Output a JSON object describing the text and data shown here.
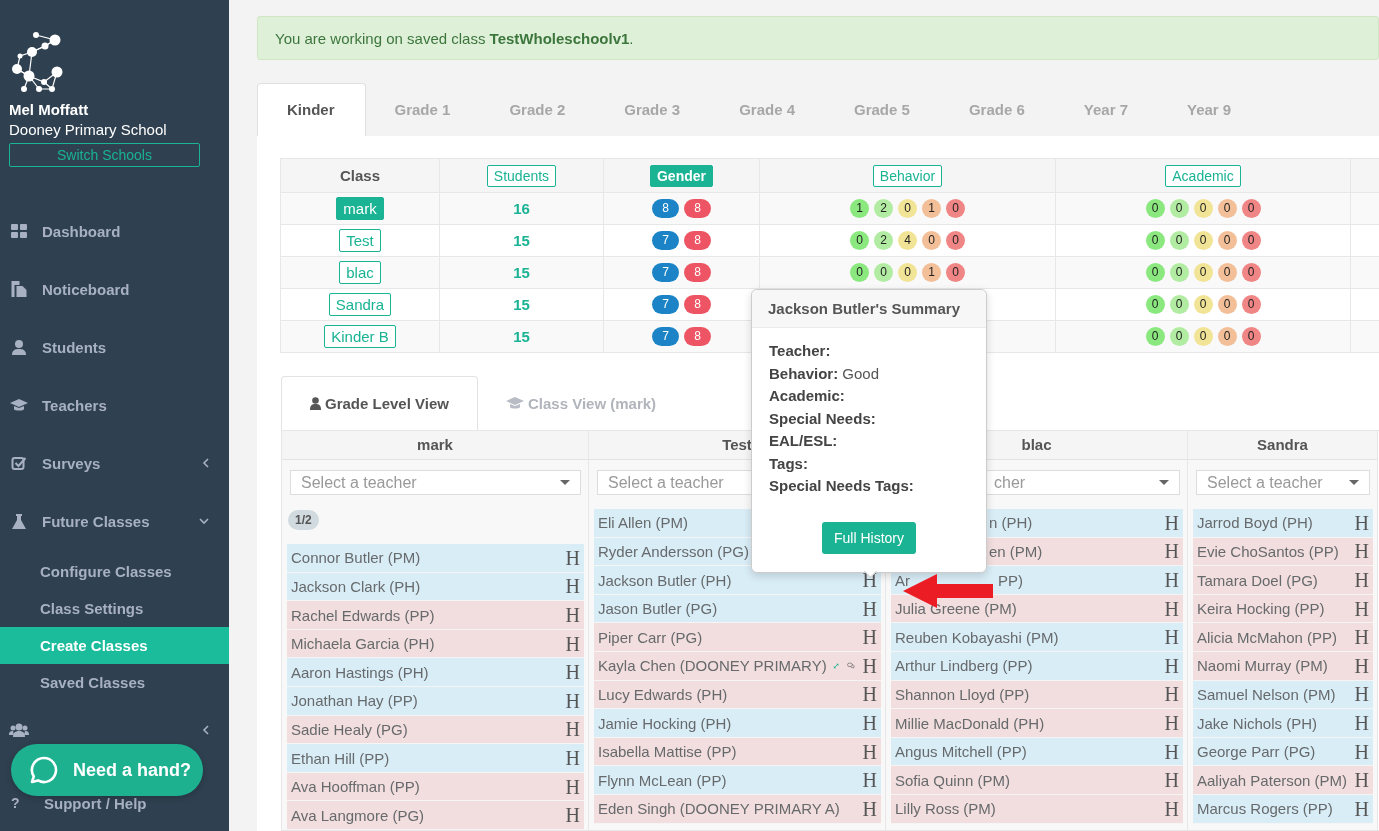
{
  "sidebar": {
    "user": "Mel Moffatt",
    "school": "Dooney Primary School",
    "switch_button": "Switch Schools",
    "nav": [
      {
        "label": "Dashboard"
      },
      {
        "label": "Noticeboard"
      },
      {
        "label": "Students"
      },
      {
        "label": "Teachers"
      },
      {
        "label": "Surveys",
        "expanded": false
      },
      {
        "label": "Future Classes",
        "expanded": true,
        "children": [
          {
            "label": "Configure Classes",
            "selected": false
          },
          {
            "label": "Class Settings",
            "selected": false
          },
          {
            "label": "Create Classes",
            "selected": true
          },
          {
            "label": "Saved Classes",
            "selected": false
          }
        ]
      },
      {
        "expanded": false
      },
      {
        "label": "Support / Help",
        "glyph": "?"
      }
    ]
  },
  "chat_button": "Need a hand?",
  "alert": "You are working on saved class **TestWholeschoolv1**.",
  "grade_tabs": [
    {
      "label": "Kinder",
      "selected": true
    },
    {
      "label": "Grade 1",
      "selected": false
    },
    {
      "label": "Grade 2",
      "selected": false
    },
    {
      "label": "Grade 3",
      "selected": false
    },
    {
      "label": "Grade 4",
      "selected": false
    },
    {
      "label": "Grade 5",
      "selected": false
    },
    {
      "label": "Grade 6",
      "selected": false
    },
    {
      "label": "Year 7",
      "selected": false
    },
    {
      "label": "Year 9",
      "selected": false
    }
  ],
  "summary": {
    "columns": [
      {
        "label": "Class",
        "kind": "plain"
      },
      {
        "label": "Students",
        "kind": "toggle",
        "selected": false
      },
      {
        "label": "Gender",
        "kind": "toggle",
        "selected": true
      },
      {
        "label": "Behavior",
        "kind": "toggle",
        "selected": false
      },
      {
        "label": "Academic",
        "kind": "toggle",
        "selected": false
      }
    ],
    "rows": [
      {
        "class": "mark",
        "selected": true,
        "students": "16",
        "boys": "8",
        "girls": "8",
        "behavior": [
          "1",
          "2",
          "0",
          "1",
          "0"
        ],
        "academic": [
          "0",
          "0",
          "0",
          "0",
          "0"
        ]
      },
      {
        "class": "Test",
        "selected": false,
        "students": "15",
        "boys": "7",
        "girls": "8",
        "behavior": [
          "0",
          "2",
          "4",
          "0",
          "0"
        ],
        "academic": [
          "0",
          "0",
          "0",
          "0",
          "0"
        ]
      },
      {
        "class": "blac",
        "selected": false,
        "students": "15",
        "boys": "7",
        "girls": "8",
        "behavior": [
          "0",
          "0",
          "0",
          "1",
          "0"
        ],
        "academic": [
          "0",
          "0",
          "0",
          "0",
          "0"
        ]
      },
      {
        "class": "Sandra",
        "selected": false,
        "students": "15",
        "boys": "7",
        "girls": "8",
        "academic": [
          "0",
          "0",
          "0",
          "0",
          "0"
        ]
      },
      {
        "class": "Kinder B",
        "selected": false,
        "students": "15",
        "boys": "7",
        "girls": "8",
        "academic": [
          "0",
          "0",
          "0",
          "0",
          "0"
        ]
      }
    ]
  },
  "view_tabs": [
    {
      "label": "Grade Level View",
      "selected": true
    },
    {
      "label": "Class View (mark)",
      "selected": false
    }
  ],
  "class_columns": [
    {
      "title": "mark",
      "select": {
        "placeholder": "Select a teacher",
        "covered": false
      },
      "page": "1/2",
      "students": [
        {
          "name": "Connor Butler (PM)",
          "color": "#d9edf7",
          "history": "H"
        },
        {
          "name": "Jackson Clark (PH)",
          "color": "#d9edf7",
          "history": "H"
        },
        {
          "name": "Rachel Edwards (PP)",
          "color": "#f2dede",
          "history": "H"
        },
        {
          "name": "Michaela Garcia (PH)",
          "color": "#f2dede",
          "history": "H"
        },
        {
          "name": "Aaron Hastings (PH)",
          "color": "#d9edf7",
          "history": "H"
        },
        {
          "name": "Jonathan Hay (PP)",
          "color": "#d9edf7",
          "history": "H"
        },
        {
          "name": "Sadie Healy (PG)",
          "color": "#f2dede",
          "history": "H"
        },
        {
          "name": "Ethan Hill (PP)",
          "color": "#d9edf7",
          "history": "H"
        },
        {
          "name": "Ava Hooffman (PP)",
          "color": "#f2dede",
          "history": "H"
        },
        {
          "name": "Ava Langmore (PG)",
          "color": "#f2dede",
          "history": "H"
        }
      ]
    },
    {
      "title": "Test",
      "select": {
        "placeholder": "Select a teacher",
        "covered": false
      },
      "students": [
        {
          "name": "Eli Allen (PM)",
          "color": "#d9edf7"
        },
        {
          "name": "Ryder Andersson (PG)",
          "color": "#d9edf7"
        },
        {
          "name": "Jackson Butler (PH)",
          "color": "#d9edf7",
          "history": "H"
        },
        {
          "name": "Jason Butler (PG)",
          "color": "#d9edf7",
          "history": "H"
        },
        {
          "name": "Piper Carr (PG)",
          "color": "#f2dede",
          "history": "H"
        },
        {
          "name": "Kayla Chen (DOONEY PRIMARY)",
          "color": "#f2dede",
          "moved": true,
          "noted": true,
          "history": "H"
        },
        {
          "name": "Lucy Edwards (PH)",
          "color": "#f2dede",
          "history": "H"
        },
        {
          "name": "Jamie Hocking (PH)",
          "color": "#d9edf7",
          "history": "H"
        },
        {
          "name": "Isabella Mattise (PP)",
          "color": "#f2dede",
          "history": "H"
        },
        {
          "name": "Flynn McLean (PP)",
          "color": "#d9edf7",
          "history": "H"
        },
        {
          "name": "Eden Singh (DOONEY PRIMARY A)",
          "color": "#f2dede",
          "history": "H"
        }
      ]
    },
    {
      "title": "blac",
      "select": {
        "placeholder": "cher",
        "covered": true
      },
      "students": [
        {
          "fragments": [
            "n (PH)"
          ],
          "color": "#d9edf7",
          "history": "H"
        },
        {
          "fragments": [
            "en (PM)"
          ],
          "color": "#f2dede",
          "history": "H"
        },
        {
          "fragments": [
            "Ar",
            "PP)"
          ],
          "color": "#d9edf7",
          "history": "H"
        },
        {
          "name": "Julia Greene (PM)",
          "color": "#f2dede",
          "history": "H"
        },
        {
          "name": "Reuben Kobayashi (PM)",
          "color": "#d9edf7",
          "history": "H"
        },
        {
          "name": "Arthur Lindberg (PP)",
          "color": "#d9edf7",
          "history": "H"
        },
        {
          "name": "Shannon Lloyd (PP)",
          "color": "#f2dede",
          "history": "H"
        },
        {
          "name": "Millie MacDonald (PH)",
          "color": "#f2dede",
          "history": "H"
        },
        {
          "name": "Angus Mitchell (PP)",
          "color": "#d9edf7",
          "history": "H"
        },
        {
          "name": "Sofia Quinn (PM)",
          "color": "#f2dede",
          "history": "H"
        },
        {
          "name": "Lilly Ross (PM)",
          "color": "#f2dede",
          "history": "H"
        }
      ]
    },
    {
      "title": "Sandra",
      "select": {
        "placeholder": "Select a teacher",
        "covered": false
      },
      "students": [
        {
          "name": "Jarrod Boyd (PH)",
          "color": "#d9edf7",
          "history": "H"
        },
        {
          "name": "Evie ChoSantos (PP)",
          "color": "#f2dede",
          "history": "H"
        },
        {
          "name": "Tamara Doel (PG)",
          "color": "#f2dede",
          "history": "H"
        },
        {
          "name": "Keira Hocking (PP)",
          "color": "#f2dede",
          "history": "H"
        },
        {
          "name": "Alicia McMahon (PP)",
          "color": "#f2dede",
          "history": "H"
        },
        {
          "name": "Naomi Murray (PM)",
          "color": "#f2dede",
          "history": "H"
        },
        {
          "name": "Samuel Nelson (PM)",
          "color": "#d9edf7",
          "history": "H"
        },
        {
          "name": "Jake Nichols (PH)",
          "color": "#d9edf7",
          "history": "H"
        },
        {
          "name": "George Parr (PG)",
          "color": "#d9edf7",
          "history": "H"
        },
        {
          "name": "Aaliyah Paterson (PM)",
          "color": "#f2dede",
          "history": "H"
        },
        {
          "name": "Marcus Rogers (PP)",
          "color": "#d9edf7",
          "history": "H"
        }
      ]
    }
  ],
  "popover": {
    "title": "Jackson Butler's Summary",
    "fields": [
      {
        "label": "Teacher:"
      },
      {
        "label": "Behavior:",
        "value": "Good"
      },
      {
        "label": "Academic:"
      },
      {
        "label": "Special Needs:"
      },
      {
        "label": "EAL/ESL:"
      },
      {
        "label": "Tags:"
      },
      {
        "label": "Special Needs Tags:"
      }
    ],
    "button": "Full History"
  },
  "overlay_arrow": {
    "kind": "arrow"
  }
}
